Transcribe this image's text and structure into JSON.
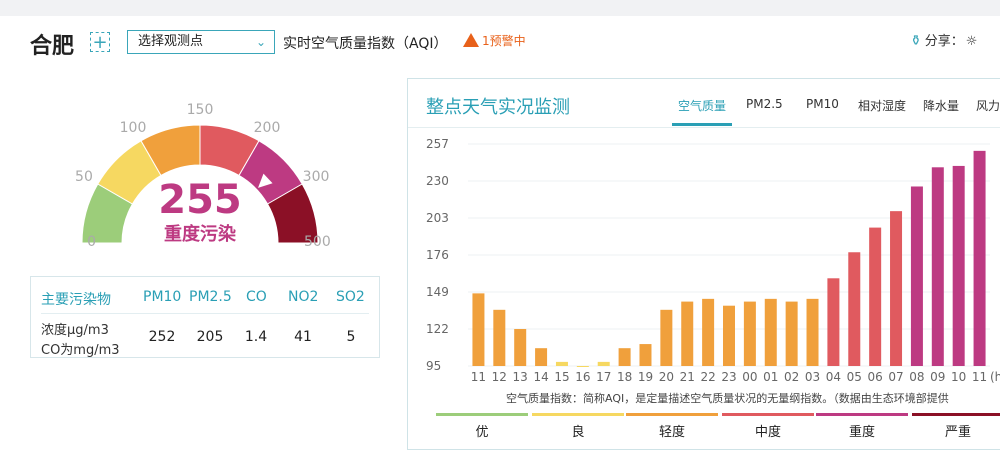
{
  "header": {
    "city": "合肥",
    "add_symbol": "+",
    "station_select": "选择观测点",
    "realtime_label": "实时空气质量指数（AQI）",
    "warning": "1预警中",
    "share_label": "分享："
  },
  "gauge": {
    "value": 255,
    "value_text": "255",
    "level_text": "重度污染",
    "max": 500,
    "ticks": [
      "0",
      "50",
      "100",
      "150",
      "200",
      "300",
      "500"
    ],
    "colors": [
      "#9ccd7a",
      "#f6d861",
      "#f0a03c",
      "#e05a5f",
      "#bd3a82",
      "#8b1026"
    ]
  },
  "pollutants": {
    "title": "主要污染物",
    "unit_line1": "浓度μg/m3",
    "unit_line2": "CO为mg/m3",
    "names": [
      "PM10",
      "PM2.5",
      "CO",
      "NO2",
      "SO2"
    ],
    "values": [
      "252",
      "205",
      "1.4",
      "41",
      "5"
    ]
  },
  "panel": {
    "title": "整点天气实况监测",
    "tabs": [
      "空气质量",
      "PM2.5",
      "PM10",
      "相对湿度",
      "降水量",
      "风力"
    ],
    "active_tab": 0,
    "note": "空气质量指数：简称AQI，是定量描述空气质量状况的无量纲指数。（数据由生态环境部提供",
    "levels": [
      {
        "label": "优",
        "color": "#9ccd7a"
      },
      {
        "label": "良",
        "color": "#f6d861"
      },
      {
        "label": "轻度",
        "color": "#f0a03c"
      },
      {
        "label": "中度",
        "color": "#e05a5f"
      },
      {
        "label": "重度",
        "color": "#bd3a82"
      },
      {
        "label": "严重",
        "color": "#8b1026"
      }
    ]
  },
  "chart_data": {
    "type": "bar",
    "ylim": [
      95,
      257
    ],
    "yticks": [
      95,
      122,
      149,
      176,
      203,
      230,
      257
    ],
    "categories": [
      "11",
      "12",
      "13",
      "14",
      "15",
      "16",
      "17",
      "18",
      "19",
      "20",
      "21",
      "22",
      "23",
      "00",
      "01",
      "02",
      "03",
      "04",
      "05",
      "06",
      "07",
      "08",
      "09",
      "10",
      "11"
    ],
    "values": [
      148,
      136,
      122,
      108,
      98,
      95,
      98,
      108,
      111,
      136,
      142,
      144,
      139,
      142,
      144,
      142,
      144,
      159,
      178,
      196,
      208,
      226,
      240,
      241,
      252
    ],
    "bar_colors": [
      "#f0a03c",
      "#f0a03c",
      "#f0a03c",
      "#f0a03c",
      "#f6d861",
      "#f6d861",
      "#f6d861",
      "#f0a03c",
      "#f0a03c",
      "#f0a03c",
      "#f0a03c",
      "#f0a03c",
      "#f0a03c",
      "#f0a03c",
      "#f0a03c",
      "#f0a03c",
      "#f0a03c",
      "#e05a5f",
      "#e05a5f",
      "#e05a5f",
      "#e05a5f",
      "#bd3a82",
      "#bd3a82",
      "#bd3a82",
      "#bd3a82"
    ],
    "unit_suffix": "(h",
    "grid": true
  }
}
